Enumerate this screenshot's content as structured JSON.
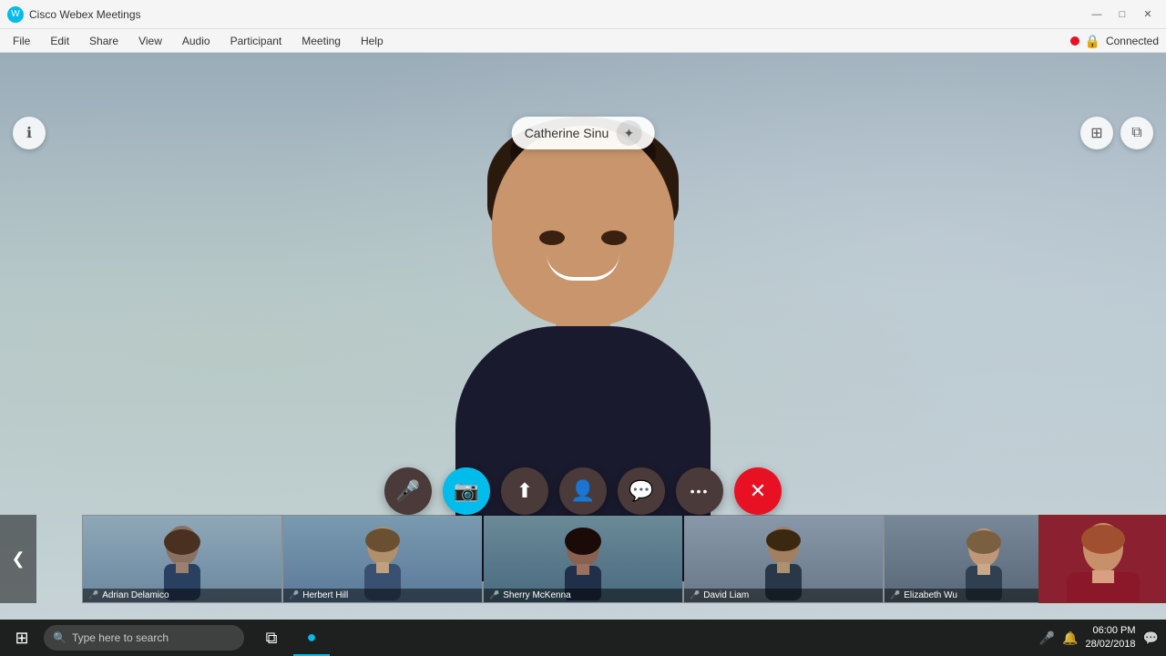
{
  "app": {
    "title": "Cisco Webex Meetings",
    "icon": "🔵"
  },
  "window_controls": {
    "minimize": "—",
    "maximize": "□",
    "close": "✕"
  },
  "menu": {
    "items": [
      "File",
      "Edit",
      "Share",
      "View",
      "Audio",
      "Participant",
      "Meeting",
      "Help"
    ]
  },
  "status": {
    "dot_color": "#e81123",
    "lock_icon": "🔒",
    "connected_label": "Connected"
  },
  "speaker": {
    "name": "Catherine Sinu",
    "star_icon": "✦"
  },
  "controls": {
    "info_icon": "ℹ",
    "layout_icon": "⊞",
    "pip_icon": "⧉",
    "mic_icon": "🎤",
    "video_icon": "📷",
    "share_icon": "⬆",
    "participants_icon": "👤",
    "chat_icon": "💬",
    "more_icon": "•••",
    "end_icon": "✕"
  },
  "thumbnails": [
    {
      "name": "Adrian Delamico",
      "muted": false,
      "has_mic": true
    },
    {
      "name": "Herbert Hill",
      "muted": true,
      "has_mic": true
    },
    {
      "name": "Sherry McKenna",
      "muted": false,
      "has_mic": true
    },
    {
      "name": "David Liam",
      "muted": false,
      "has_mic": true
    },
    {
      "name": "Elizabeth Wu",
      "muted": false,
      "has_mic": true
    }
  ],
  "navigation": {
    "prev": "❮",
    "next": "❯"
  },
  "taskbar": {
    "search_placeholder": "Type here to search",
    "time": "06:00 PM",
    "date": "28/02/2018"
  }
}
